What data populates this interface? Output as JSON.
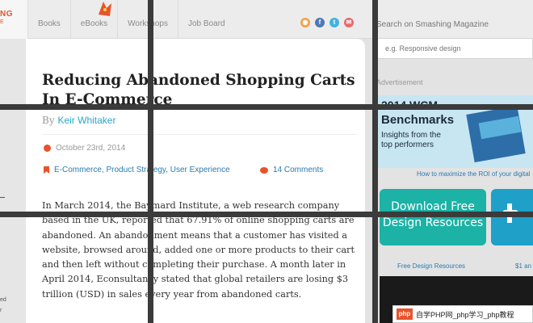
{
  "header": {
    "logo_line1": "NG",
    "logo_line2": "E",
    "nav": [
      "Books",
      "eBooks",
      "Workshops",
      "Job Board"
    ],
    "social_icons": [
      "rss-icon",
      "facebook-icon",
      "twitter-icon",
      "email-icon"
    ],
    "search_label": "Search on Smashing Magazine",
    "search_placeholder": "e.g. Responsive design"
  },
  "article": {
    "title": "Reducing Abandoned Shopping Carts In E-Commerce",
    "by": "By",
    "author": "Keir Whitaker",
    "date": "October 23rd, 2014",
    "tags": "E-Commerce, Product Strategy, User Experience",
    "comments": "14 Comments",
    "body": "In March 2014, the Baymard Institute, a web research company based in the UK, reported that 67.91% of online shopping carts are abandoned. An abandonment means that a customer has visited a website, browsed around, added one or more products to their cart and then left without completing their purchase. A month later in April 2014, Econsultancy stated that global retailers are losing $3 trillion (USD) in sales every year from abandoned carts."
  },
  "sidebar": {
    "ad_label": "Advertisement",
    "banner_line1": "2014 WCM",
    "banner_line2": "Benchmarks",
    "banner_line3": "Insights from the top performers",
    "roi_link": "How to maximize the ROI of your digital",
    "download_line1": "Download Free",
    "download_line2": "Design Resources",
    "free_link": "Free Design Resources",
    "price": "$1 an"
  },
  "watermark": {
    "logo": "php",
    "text": "自学PHP网_php学习_php教程"
  },
  "colors": {
    "accent": "#e8532b",
    "link": "#2a7ab0",
    "teal": "#1cb2a6"
  }
}
